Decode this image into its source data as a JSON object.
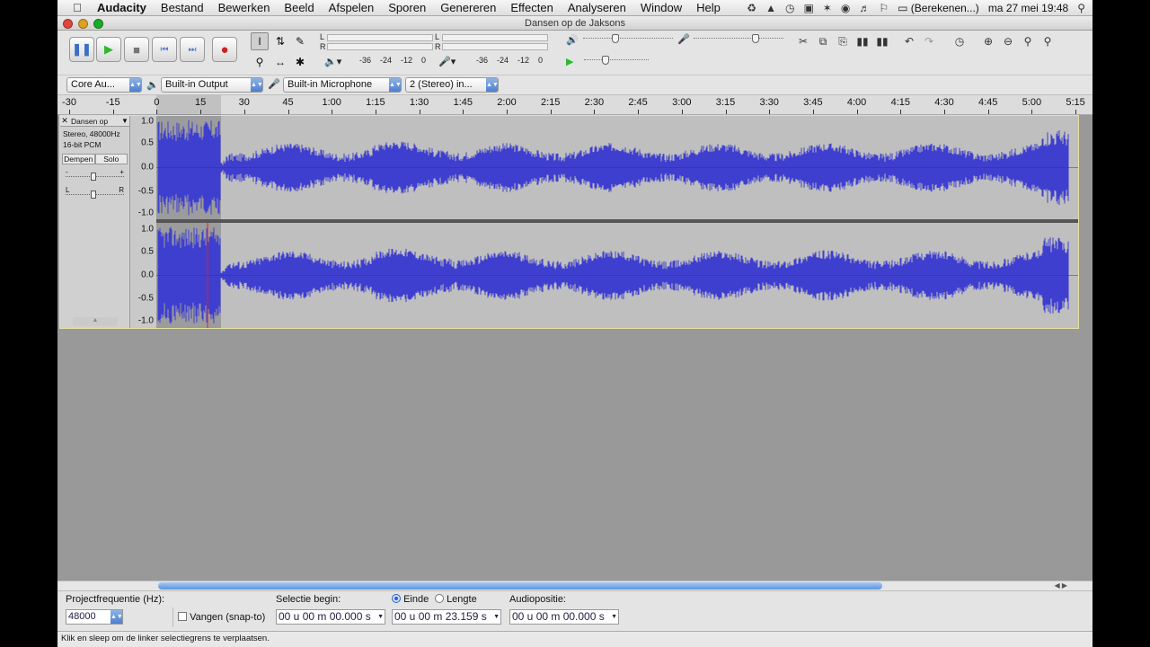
{
  "menubar": {
    "app_name": "Audacity",
    "items": [
      "Bestand",
      "Bewerken",
      "Beeld",
      "Afspelen",
      "Sporen",
      "Genereren",
      "Effecten",
      "Analyseren",
      "Window",
      "Help"
    ],
    "battery_text": "(Berekenen...)",
    "clock": "ma 27 mei  19:48"
  },
  "window": {
    "title": "Dansen op de Jaksons"
  },
  "meters": {
    "left_channel": "L",
    "right_channel": "R",
    "play_scale": [
      "-36",
      "-24",
      "-12",
      "0"
    ],
    "rec_scale": [
      "-36",
      "-24",
      "-12",
      "0"
    ]
  },
  "devices": {
    "host": "Core Au...",
    "output": "Built-in Output",
    "input": "Built-in Microphone",
    "channels": "2 (Stereo) in..."
  },
  "ruler": {
    "labels": [
      "-30",
      "-15",
      "0",
      "15",
      "30",
      "45",
      "1:00",
      "1:15",
      "1:30",
      "1:45",
      "2:00",
      "2:15",
      "2:30",
      "2:45",
      "3:00",
      "3:15",
      "3:30",
      "3:45",
      "4:00",
      "4:15",
      "4:30",
      "4:45",
      "5:00",
      "5:15"
    ]
  },
  "track": {
    "name": "Dansen op",
    "format_line1": "Stereo, 48000Hz",
    "format_line2": "16-bit PCM",
    "mute_label": "Dempen",
    "solo_label": "Solo",
    "gain_minus": "-",
    "gain_plus": "+",
    "pan_left": "L",
    "pan_right": "R",
    "scale_labels": [
      "1.0",
      "0.5",
      "0.0",
      "-0.5",
      "-1.0"
    ]
  },
  "selection_bar": {
    "rate_label": "Projectfrequentie (Hz):",
    "rate_value": "48000",
    "snap_label": "Vangen (snap-to)",
    "sel_begin_label": "Selectie begin:",
    "end_label": "Einde",
    "length_label": "Lengte",
    "audio_pos_label": "Audiopositie:",
    "sel_begin_value": "00 u 00 m 00.000 s",
    "sel_end_value": "00 u 00 m 23.159 s",
    "audio_pos_value": "00 u 00 m 00.000 s"
  },
  "status": {
    "text": "Klik en sleep om de linker selectiegrens te verplaatsen."
  },
  "colors": {
    "waveform": "#3f3fcf",
    "selection": "#9c9c9c",
    "track_bg": "#bfbfbf",
    "accent": "#4d7fd0"
  }
}
